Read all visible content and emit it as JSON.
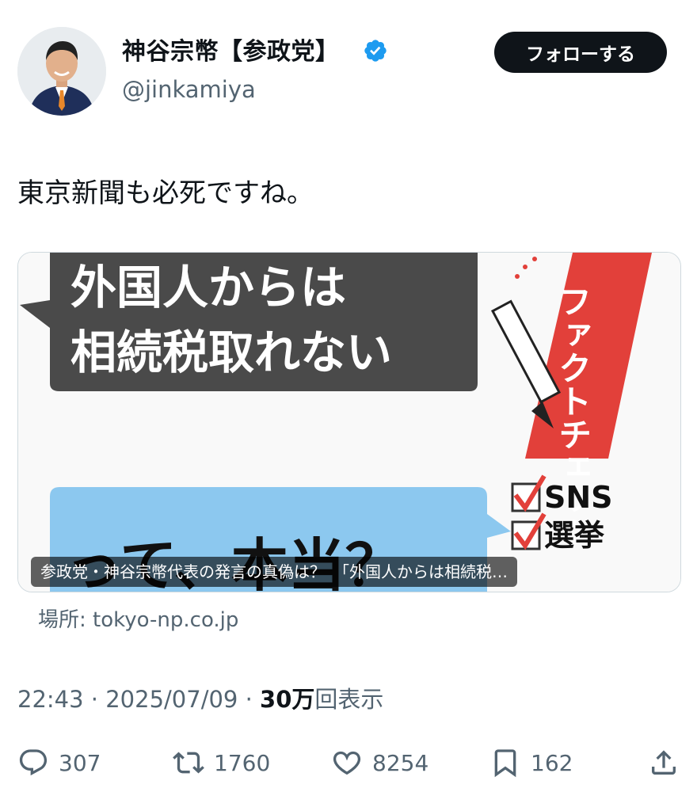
{
  "author": {
    "name": "神谷宗幣【参政党】",
    "handle": "@jinkamiya"
  },
  "follow_label": "フォローする",
  "tweet_text": "東京新聞も必死ですね。",
  "card": {
    "image_text_top_line1": "外国人からは",
    "image_text_top_line2": "相続税取れない",
    "image_text_bottom": "って、本当？",
    "image_side_text": "ファクトチェック",
    "image_check_1": "SNS",
    "image_check_2": "選挙",
    "caption": "参政党・神谷宗幣代表の発言の真偽は？　「外国人からは相続税…",
    "source": "場所: tokyo-np.co.jp"
  },
  "meta": {
    "time": "22:43",
    "date": "2025/07/09",
    "views": "30万",
    "views_label": "回表示",
    "sep": "·"
  },
  "actions": {
    "replies": "307",
    "retweets": "1760",
    "likes": "8254",
    "bookmarks": "162"
  },
  "colors": {
    "verified": "#1d9bf0",
    "follow_bg": "#0f1419",
    "card_red": "#e2403a",
    "bubble_dark": "#444444",
    "bubble_blue": "#8cc8ef"
  },
  "icons": [
    "verified-badge-icon",
    "reply-icon",
    "retweet-icon",
    "like-icon",
    "bookmark-icon",
    "share-icon"
  ]
}
